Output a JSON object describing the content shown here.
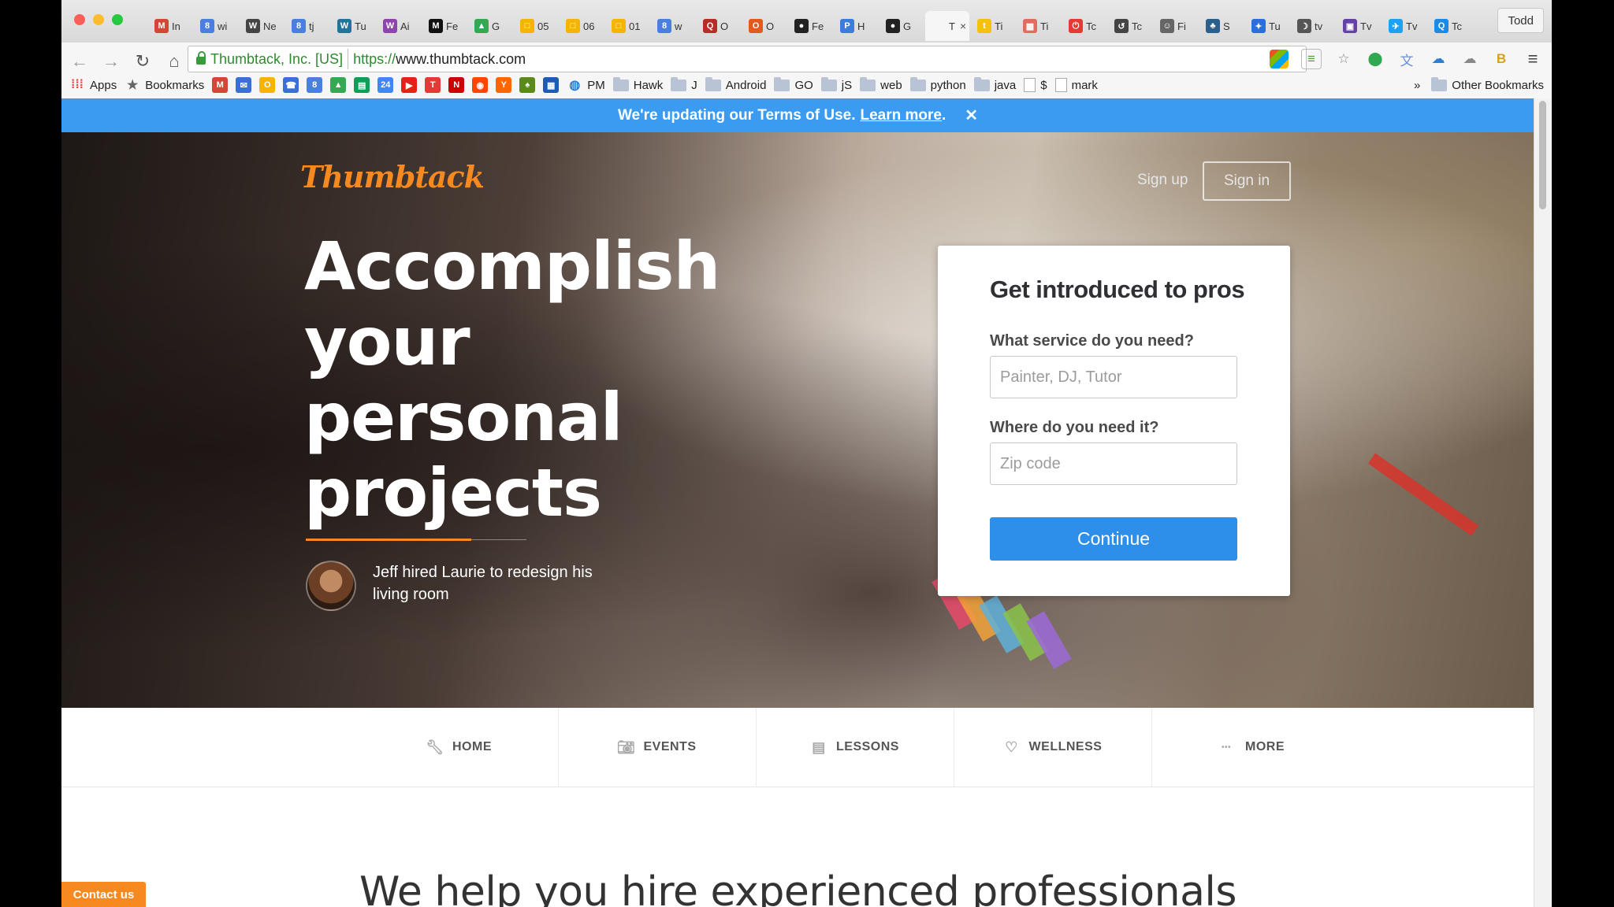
{
  "browser": {
    "user_name": "Todd",
    "tabs": [
      {
        "label": "In",
        "icon": "gmail-icon",
        "glyph": "M",
        "color": "#d44638"
      },
      {
        "label": "wi",
        "icon": "google-icon",
        "glyph": "8",
        "color": "#4a7fe0"
      },
      {
        "label": "Ne",
        "icon": "wikipedia-icon",
        "glyph": "W",
        "color": "#444444"
      },
      {
        "label": "tj",
        "icon": "google-icon",
        "glyph": "8",
        "color": "#4a7fe0"
      },
      {
        "label": "Tu",
        "icon": "wordpress-icon",
        "glyph": "W",
        "color": "#21759b"
      },
      {
        "label": "Ai",
        "icon": "w-icon",
        "glyph": "W",
        "color": "#8e44ad"
      },
      {
        "label": "Fe",
        "icon": "medium-icon",
        "glyph": "M",
        "color": "#111111"
      },
      {
        "label": "G",
        "icon": "drive-icon",
        "glyph": "▲",
        "color": "#34a853"
      },
      {
        "label": "05",
        "icon": "chat-icon",
        "glyph": "□",
        "color": "#f4b400"
      },
      {
        "label": "06",
        "icon": "chat-icon",
        "glyph": "□",
        "color": "#f4b400"
      },
      {
        "label": "01",
        "icon": "chat-icon",
        "glyph": "□",
        "color": "#f4b400"
      },
      {
        "label": "w",
        "icon": "google-icon",
        "glyph": "8",
        "color": "#4a7fe0"
      },
      {
        "label": "O",
        "icon": "quora-icon",
        "glyph": "Q",
        "color": "#b92b27"
      },
      {
        "label": "O",
        "icon": "office-icon",
        "glyph": "O",
        "color": "#e35a1c"
      },
      {
        "label": "Fe",
        "icon": "github-icon",
        "glyph": "●",
        "color": "#222222"
      },
      {
        "label": "H",
        "icon": "p-icon",
        "glyph": "P",
        "color": "#3b7ddd"
      },
      {
        "label": "G",
        "icon": "github-icon",
        "glyph": "●",
        "color": "#222222"
      },
      {
        "label": "T",
        "icon": "thumbtack-tab-icon",
        "glyph": "",
        "color": "#f6f6f6",
        "active": true
      },
      {
        "label": "Ti",
        "icon": "t-icon",
        "glyph": "t",
        "color": "#f4c20d"
      },
      {
        "label": "Ti",
        "icon": "grid-icon",
        "glyph": "▦",
        "color": "#e46b5f"
      },
      {
        "label": "Tc",
        "icon": "power-icon",
        "glyph": "⏻",
        "color": "#e53935"
      },
      {
        "label": "Tc",
        "icon": "swirl-icon",
        "glyph": "↺",
        "color": "#444444"
      },
      {
        "label": "Fi",
        "icon": "robot-icon",
        "glyph": "☺",
        "color": "#666666"
      },
      {
        "label": "S",
        "icon": "leaf-icon",
        "glyph": "♣",
        "color": "#2b5f8c"
      },
      {
        "label": "Tu",
        "icon": "puzzle-icon",
        "glyph": "✦",
        "color": "#2a6fdb"
      },
      {
        "label": "tv",
        "icon": "moon-icon",
        "glyph": "☽",
        "color": "#555555"
      },
      {
        "label": "Tv",
        "icon": "twitch-icon",
        "glyph": "▣",
        "color": "#6441a5"
      },
      {
        "label": "Tv",
        "icon": "twitter-icon",
        "glyph": "✈",
        "color": "#1da1f2"
      },
      {
        "label": "Tc",
        "icon": "q-icon",
        "glyph": "Q",
        "color": "#1e88e5"
      }
    ],
    "address": {
      "ev_label": "Thumbtack, Inc. [US]",
      "scheme": "https://",
      "host": "www.thumbtack.com"
    },
    "bookmarks": [
      {
        "label": "Apps",
        "type": "apps"
      },
      {
        "label": "Bookmarks",
        "type": "star"
      },
      {
        "label": "",
        "type": "icon",
        "glyph": "M",
        "color": "#d44638"
      },
      {
        "label": "",
        "type": "icon",
        "glyph": "✉",
        "color": "#3b6fd8"
      },
      {
        "label": "",
        "type": "icon",
        "glyph": "O",
        "color": "#f4b400"
      },
      {
        "label": "",
        "type": "icon",
        "glyph": "☎",
        "color": "#3b6fd8"
      },
      {
        "label": "",
        "type": "icon",
        "glyph": "8",
        "color": "#4a7fe0"
      },
      {
        "label": "",
        "type": "icon",
        "glyph": "▲",
        "color": "#34a853"
      },
      {
        "label": "",
        "type": "icon",
        "glyph": "▤",
        "color": "#0f9d58"
      },
      {
        "label": "",
        "type": "icon",
        "glyph": "24",
        "color": "#4285f4"
      },
      {
        "label": "",
        "type": "icon",
        "glyph": "▶",
        "color": "#e62117"
      },
      {
        "label": "",
        "type": "icon",
        "glyph": "T",
        "color": "#e53935"
      },
      {
        "label": "",
        "type": "icon",
        "glyph": "N",
        "color": "#cc0000"
      },
      {
        "label": "",
        "type": "icon",
        "glyph": "◉",
        "color": "#ff4500"
      },
      {
        "label": "",
        "type": "icon",
        "glyph": "Y",
        "color": "#ff6600"
      },
      {
        "label": "",
        "type": "icon",
        "glyph": "♠",
        "color": "#5a8a1a"
      },
      {
        "label": "",
        "type": "icon",
        "glyph": "▦",
        "color": "#1e5cb3"
      },
      {
        "label": "PM",
        "type": "globe"
      },
      {
        "label": "Hawk",
        "type": "folder"
      },
      {
        "label": "J",
        "type": "folder"
      },
      {
        "label": "Android",
        "type": "folder"
      },
      {
        "label": "GO",
        "type": "folder"
      },
      {
        "label": "jS",
        "type": "folder"
      },
      {
        "label": "web",
        "type": "folder"
      },
      {
        "label": "python",
        "type": "folder"
      },
      {
        "label": "java",
        "type": "folder"
      },
      {
        "label": "$",
        "type": "page"
      },
      {
        "label": "mark",
        "type": "page"
      }
    ],
    "overflow_label": "»",
    "other_bookmarks": "Other Bookmarks"
  },
  "banner": {
    "text": "We're updating our Terms of Use.",
    "link": "Learn more",
    "period": ".",
    "close": "✕"
  },
  "hero": {
    "logo": "Thumbtack",
    "signup": "Sign up",
    "signin": "Sign in",
    "headline": [
      "Accomplish",
      "your personal",
      "projects"
    ],
    "testimonial": "Jeff hired Laurie to redesign his living room"
  },
  "form": {
    "title": "Get introduced to pros",
    "service_label": "What service do you need?",
    "service_placeholder": "Painter, DJ, Tutor",
    "zip_label": "Where do you need it?",
    "zip_placeholder": "Zip code",
    "continue": "Continue"
  },
  "categories": [
    {
      "label": "HOME",
      "icon": "wrench-icon",
      "glyph": "🔧︎"
    },
    {
      "label": "EVENTS",
      "icon": "camera-icon",
      "glyph": "📷︎"
    },
    {
      "label": "LESSONS",
      "icon": "book-icon",
      "glyph": "▤"
    },
    {
      "label": "WELLNESS",
      "icon": "heart-icon",
      "glyph": "♡"
    },
    {
      "label": "MORE",
      "icon": "more-dots-icon",
      "glyph": "•••"
    }
  ],
  "section_title": "We help you hire experienced professionals",
  "contact": "Contact us",
  "colors": {
    "brand_orange": "#f6891f",
    "banner_blue": "#3a9bf0",
    "button_blue": "#2d8fea"
  }
}
